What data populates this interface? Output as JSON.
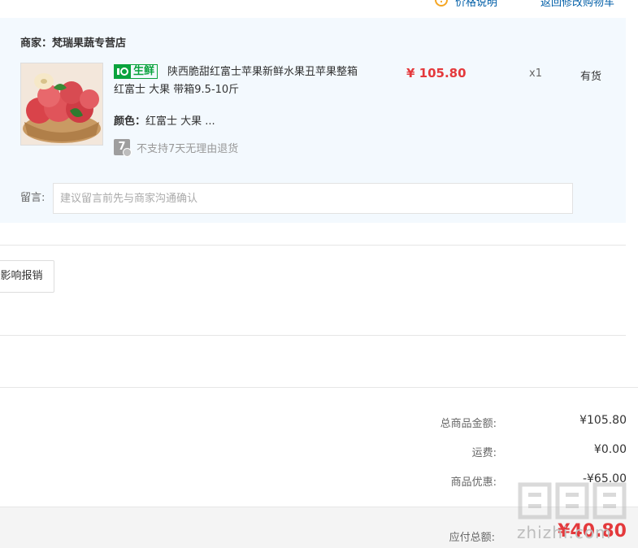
{
  "header": {
    "help_link": "价格说明",
    "back_link": "返回修改购物车"
  },
  "shop": {
    "label": "商家：",
    "name": "梵瑞果蔬专营店"
  },
  "product": {
    "tag": "生鲜",
    "title": "陕西脆甜红富士苹果新鲜水果丑苹果整箱 红富士 大果 带箱9.5-10斤",
    "price": "¥ 105.80",
    "quantity": "x1",
    "stock": "有货",
    "attr_label": "颜色：",
    "attr_value": "红富士 大果 ...",
    "no_return_icon_char": "7",
    "no_return_text": "不支持7天无理由退货"
  },
  "message": {
    "label": "留言:",
    "placeholder": "建议留言前先与商家沟通确认",
    "value": ""
  },
  "receipt": {
    "button_label": "影响报销"
  },
  "summary": {
    "goods_label": "总商品金额:",
    "goods_value": "¥105.80",
    "shipping_label": "运费:",
    "shipping_value": "¥0.00",
    "discount_label": "商品优惠:",
    "discount_value": "-¥65.00",
    "total_label": "应付总额:",
    "total_value": "¥40.80"
  },
  "watermark": {
    "text": "zhizhi.com"
  },
  "colors": {
    "price_red": "#e4393c",
    "fresh_green": "#0aa33d",
    "panel_bg": "#f3f9fe",
    "link_blue": "#005ea7",
    "help_orange": "#f5a623"
  }
}
